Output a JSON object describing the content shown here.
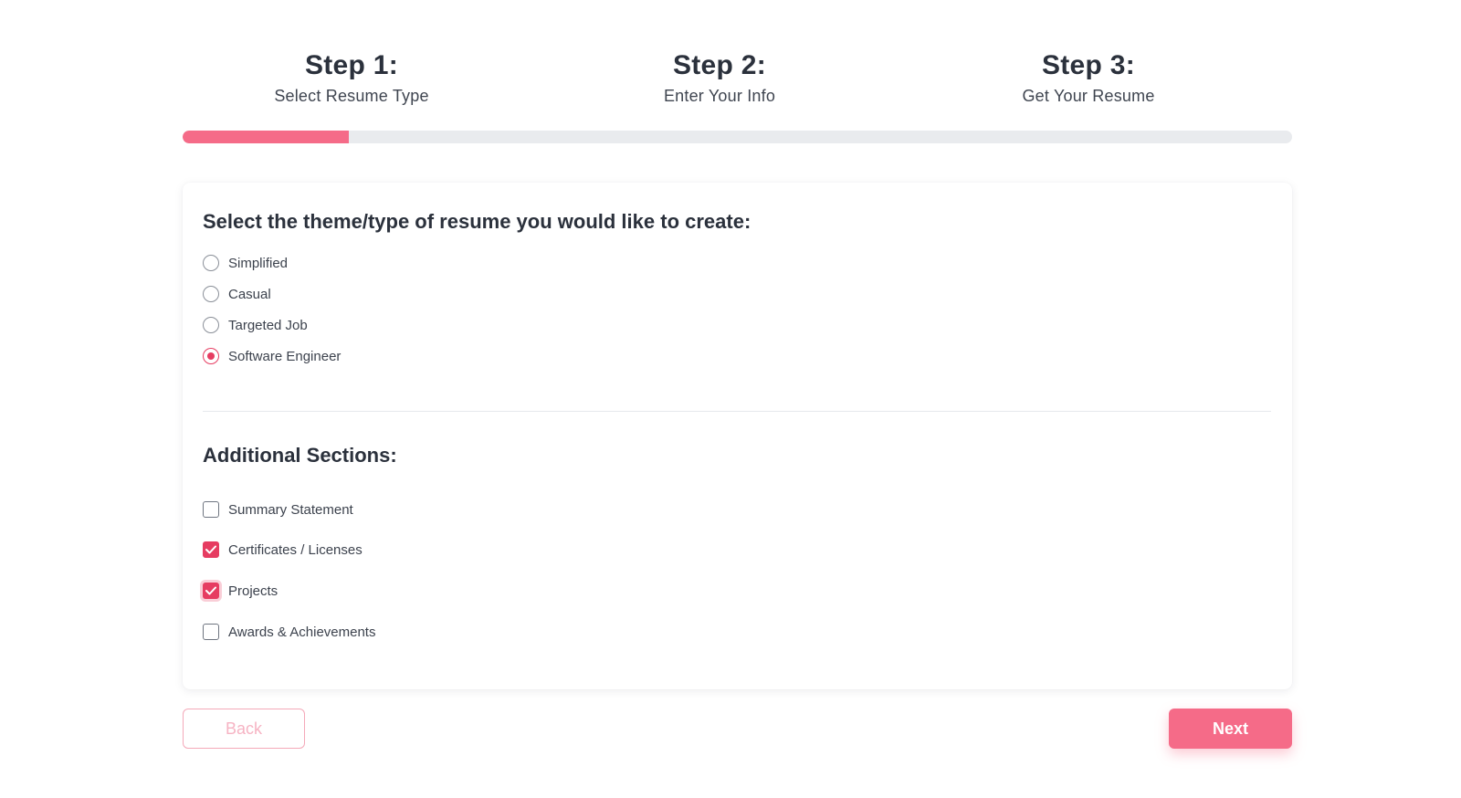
{
  "steps": [
    {
      "title": "Step 1:",
      "subtitle": "Select Resume Type"
    },
    {
      "title": "Step 2:",
      "subtitle": "Enter Your Info"
    },
    {
      "title": "Step 3:",
      "subtitle": "Get Your Resume"
    }
  ],
  "progress": {
    "fraction": 0.15
  },
  "theme": {
    "heading": "Select the theme/type of resume you would like to create:",
    "selected": "Software Engineer",
    "options": [
      {
        "label": "Simplified",
        "checked": false
      },
      {
        "label": "Casual",
        "checked": false
      },
      {
        "label": "Targeted Job",
        "checked": false
      },
      {
        "label": "Software Engineer",
        "checked": true
      }
    ]
  },
  "sections": {
    "heading": "Additional Sections:",
    "options": [
      {
        "label": "Summary Statement",
        "checked": false
      },
      {
        "label": "Certificates / Licenses",
        "checked": true
      },
      {
        "label": "Projects",
        "checked": true,
        "focused": true
      },
      {
        "label": "Awards & Achievements",
        "checked": false
      }
    ]
  },
  "buttons": {
    "back_label": "Back",
    "next_label": "Next"
  },
  "colors": {
    "accent": "#f56b88",
    "checked": "#e63c61",
    "track": "#e9ebee"
  }
}
